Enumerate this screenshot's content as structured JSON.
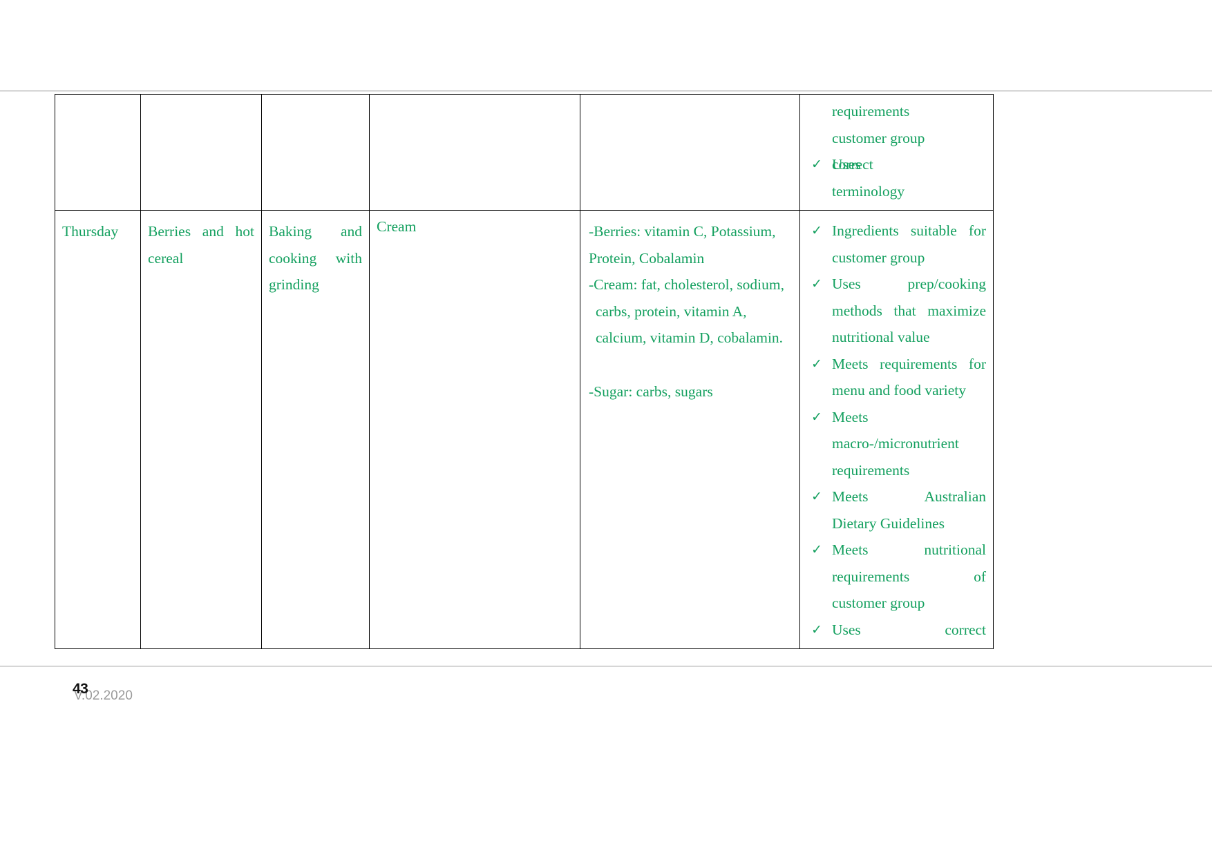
{
  "document": {
    "page_number": "43",
    "version_date": "V.02.2020"
  },
  "table": {
    "rows": [
      {
        "id": "continuation-row",
        "day": "",
        "dish": "",
        "method": "",
        "ingredient": "",
        "nutrition": [],
        "checklist_continuation": [
          "requirements",
          "customer group"
        ],
        "checklist": [
          {
            "lead": "Uses",
            "tail": "correct",
            "wrap": "terminology"
          }
        ]
      },
      {
        "id": "thursday-row",
        "day": "Thursday",
        "dish": "Berries and hot cereal",
        "method": "Baking and cooking with grinding",
        "ingredient": "Cream",
        "nutrition": [
          "-Berries: vitamin C, Potassium, Protein, Cobalamin",
          "-Cream: fat, cholesterol, sodium, carbs, protein, vitamin A, calcium, vitamin D, cobalamin.",
          "-Sugar: carbs, sugars"
        ],
        "checklist": [
          {
            "text": "Ingredients suitable for customer group"
          },
          {
            "text": "Uses prep/cooking methods that maximize nutritional value"
          },
          {
            "text": "Meets requirements for menu and food variety"
          },
          {
            "text": "Meets macro-/micronutrient requirements"
          },
          {
            "text": "Meets Australian Dietary Guidelines"
          },
          {
            "text": "Meets nutritional requirements of customer group"
          },
          {
            "text": "Uses correct"
          }
        ]
      }
    ]
  },
  "colors": {
    "text_green": "#14a05f",
    "border": "#000000",
    "rule": "#b8b8b8",
    "footer_version_gray": "#9a9a9a"
  },
  "icons": {
    "check": "✓"
  },
  "cells": {
    "r1_check_frag_1": "requirements",
    "r1_check_frag_2": "customer group",
    "r1_item1_a": "Uses",
    "r1_item1_b": "correct",
    "r1_item1_c": "terminology",
    "r2_day": "Thursday",
    "r2_dish_a": "Berries  and  hot",
    "r2_dish_b": "cereal",
    "r2_method_a": "Baking",
    "r2_method_b": "and",
    "r2_method_c": "cooking",
    "r2_method_d": "with",
    "r2_method_e": "grinding",
    "r2_ingredient": "Cream",
    "r2_nut1_a": "-Berries:  vitamin  C,  Potassium,",
    "r2_nut1_b": "Protein, Cobalamin",
    "r2_nut2_a": "-Cream: fat, cholesterol, sodium,",
    "r2_nut2_b": "carbs,    protein,    vitamin    A,",
    "r2_nut2_c": "calcium, vitamin D, cobalamin.",
    "r2_nut3": "-Sugar: carbs, sugars",
    "r2_i1_a": "Ingredients  suitable  for",
    "r2_i1_b": "customer group",
    "r2_i2_a": "Uses",
    "r2_i2_b": "prep/cooking",
    "r2_i2_c": "methods  that  maximize",
    "r2_i2_d": "nutritional value",
    "r2_i3_a": "Meets  requirements  for",
    "r2_i3_b": "menu and food variety",
    "r2_i4_a": "Meets",
    "r2_i4_b": "macro-/micronutrient",
    "r2_i4_c": "requirements",
    "r2_i5_a": "Meets",
    "r2_i5_b": "Australian",
    "r2_i5_c": "Dietary Guidelines",
    "r2_i6_a": "Meets",
    "r2_i6_b": "nutritional",
    "r2_i6_c": "requirements",
    "r2_i6_d": "of",
    "r2_i6_e": "customer group",
    "r2_i7_a": "Uses",
    "r2_i7_b": "correct"
  }
}
